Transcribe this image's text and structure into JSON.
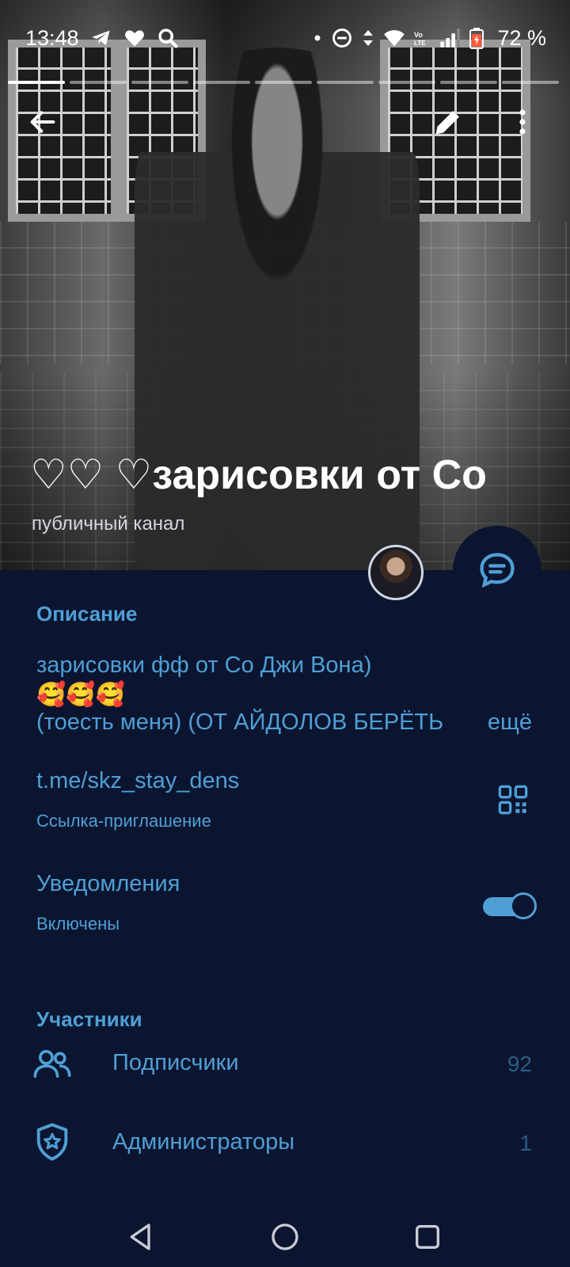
{
  "status_bar": {
    "time": "13:48",
    "battery_percent": "72 %"
  },
  "header": {
    "channel_title": "♡♡     ♡зарисовки от Со",
    "channel_type": "публичный канал"
  },
  "description": {
    "header": "Описание",
    "line1": "зарисовки фф от Со Джи Вона)",
    "line2": "🥰🥰🥰",
    "line3": "(тоесть меня) (ОТ АЙДОЛОВ БЕРЁТЬ",
    "more": "ещё"
  },
  "invite_link": {
    "value": "t.me/skz_stay_dens",
    "label": "Ссылка-приглашение"
  },
  "notifications": {
    "label": "Уведомления",
    "status": "Включены",
    "enabled": true
  },
  "members": {
    "header": "Участники",
    "rows": [
      {
        "label": "Подписчики",
        "count": "92",
        "icon": "people-icon"
      },
      {
        "label": "Администраторы",
        "count": "1",
        "icon": "admin-shield-icon"
      }
    ]
  },
  "colors": {
    "accent": "#4f9fd5",
    "panel_bg": "#0b1530",
    "count_text": "#2c5c86"
  }
}
